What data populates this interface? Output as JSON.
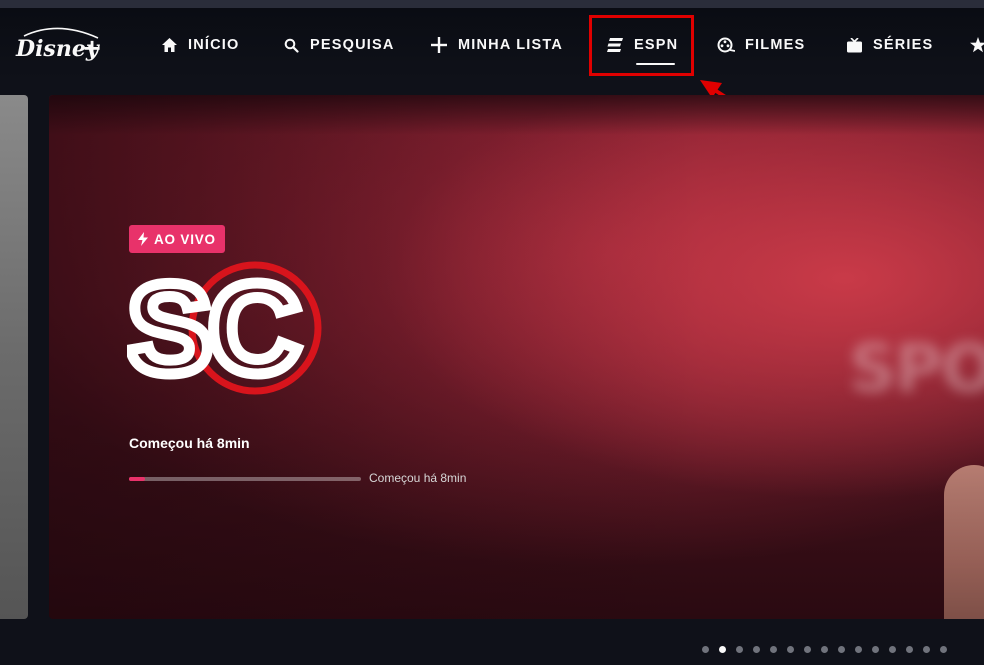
{
  "nav": {
    "items": [
      {
        "label": "INÍCIO",
        "icon": "home-icon"
      },
      {
        "label": "PESQUISA",
        "icon": "search-icon"
      },
      {
        "label": "MINHA LISTA",
        "icon": "plus-icon"
      },
      {
        "label": "ESPN",
        "icon": "espn-icon"
      },
      {
        "label": "FILMES",
        "icon": "film-reel-icon"
      },
      {
        "label": "SÉRIES",
        "icon": "tv-icon"
      },
      {
        "label": "",
        "icon": "star-icon"
      }
    ],
    "active": "ESPN"
  },
  "hero": {
    "badge": "AO VIVO",
    "logo_text": "SC",
    "status": "Começou há 8min",
    "progress_label": "Começou há 8min",
    "progress": 0.07
  },
  "carousel": {
    "dots": 15,
    "active_index": 1
  },
  "colors": {
    "background": "#0f1119",
    "live_pink": "#e8326a",
    "highlight_red": "#e00000"
  }
}
